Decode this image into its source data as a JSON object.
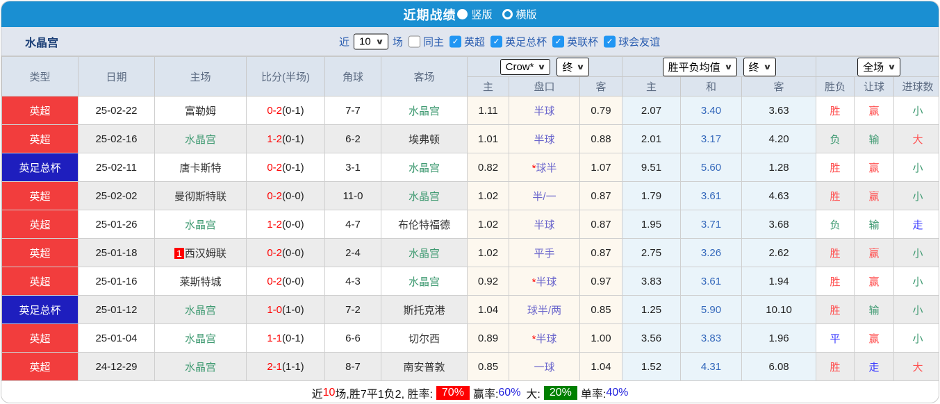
{
  "icons": {
    "chevron_down": "∨",
    "check": "✓"
  },
  "colors": {
    "titlebar_blue": "#1a8fd2",
    "filterbar_gray": "#e1e6ef",
    "header_gray": "#dce4ee",
    "type_red": "#f23d3d",
    "type_blue": "#1e1ebe",
    "team_green": "#3d9970",
    "score_red": "#fe0000",
    "handicap_purple": "#6b66cc",
    "draw_blue": "#3468bb",
    "result_red": "#ff5252",
    "result_green": "#3d9970",
    "result_blue": "#3b3bff",
    "asia_bg": "#fdf8ef",
    "euro_bg": "#eaf4fa",
    "checkbox_blue": "#2196f3",
    "badge_red": "#fe0000",
    "badge_green": "#008000"
  },
  "title_bar": {
    "title": "近期战绩",
    "vertical_label": "竖版",
    "horizontal_label": "横版"
  },
  "filter_bar": {
    "team": "水晶宫",
    "near_label": "近",
    "count_value": "10",
    "unit_label": "场",
    "same_home": {
      "label": "同主",
      "state": "unchecked"
    },
    "leagues": [
      {
        "label": "英超",
        "state": "checked"
      },
      {
        "label": "英足总杯",
        "state": "checked"
      },
      {
        "label": "英联杯",
        "state": "checked"
      },
      {
        "label": "球会友谊",
        "state": "checked"
      }
    ]
  },
  "table": {
    "selects": {
      "bookmaker": "Crow*",
      "asia_stage": "终",
      "euro_name": "胜平负均值",
      "euro_stage": "终",
      "scope": "全场"
    },
    "headers": {
      "type": "类型",
      "date": "日期",
      "home": "主场",
      "score": "比分(半场)",
      "corner": "角球",
      "away": "客场",
      "asia_home": "主",
      "handicap": "盘口",
      "asia_away": "客",
      "euro_home": "主",
      "euro_draw": "和",
      "euro_away": "客",
      "result": "胜负",
      "let_result": "让球",
      "goals": "进球数"
    },
    "rows": [
      {
        "type": "英超",
        "type_color": "red",
        "date": "25-02-22",
        "rank": "",
        "home": "富勒姆",
        "home_color": "dark",
        "score": "0-2",
        "half": "(0-1)",
        "corner": "7-7",
        "away": "水晶宫",
        "away_color": "green",
        "asia_home": "1.11",
        "star": "",
        "handicap": "半球",
        "asia_away": "0.79",
        "euro_home": "2.07",
        "euro_draw": "3.40",
        "euro_away": "3.63",
        "result": "胜",
        "result_color": "red",
        "let_result": "赢",
        "let_color": "red",
        "goal": "小",
        "goal_color": "green"
      },
      {
        "type": "英超",
        "type_color": "red",
        "date": "25-02-16",
        "rank": "",
        "home": "水晶宫",
        "home_color": "green",
        "score": "1-2",
        "half": "(0-1)",
        "corner": "6-2",
        "away": "埃弗顿",
        "away_color": "dark",
        "asia_home": "1.01",
        "star": "",
        "handicap": "半球",
        "asia_away": "0.88",
        "euro_home": "2.01",
        "euro_draw": "3.17",
        "euro_away": "4.20",
        "result": "负",
        "result_color": "green",
        "let_result": "输",
        "let_color": "green",
        "goal": "大",
        "goal_color": "red"
      },
      {
        "type": "英足总杯",
        "type_color": "blue",
        "date": "25-02-11",
        "rank": "",
        "home": "唐卡斯特",
        "home_color": "dark",
        "score": "0-2",
        "half": "(0-1)",
        "corner": "3-1",
        "away": "水晶宫",
        "away_color": "green",
        "asia_home": "0.82",
        "star": "*",
        "handicap": "球半",
        "asia_away": "1.07",
        "euro_home": "9.51",
        "euro_draw": "5.60",
        "euro_away": "1.28",
        "result": "胜",
        "result_color": "red",
        "let_result": "赢",
        "let_color": "red",
        "goal": "小",
        "goal_color": "green"
      },
      {
        "type": "英超",
        "type_color": "red",
        "date": "25-02-02",
        "rank": "",
        "home": "曼彻斯特联",
        "home_color": "dark",
        "score": "0-2",
        "half": "(0-0)",
        "corner": "11-0",
        "away": "水晶宫",
        "away_color": "green",
        "asia_home": "1.02",
        "star": "",
        "handicap": "半/一",
        "asia_away": "0.87",
        "euro_home": "1.79",
        "euro_draw": "3.61",
        "euro_away": "4.63",
        "result": "胜",
        "result_color": "red",
        "let_result": "赢",
        "let_color": "red",
        "goal": "小",
        "goal_color": "green"
      },
      {
        "type": "英超",
        "type_color": "red",
        "date": "25-01-26",
        "rank": "",
        "home": "水晶宫",
        "home_color": "green",
        "score": "1-2",
        "half": "(0-0)",
        "corner": "4-7",
        "away": "布伦特福德",
        "away_color": "dark",
        "asia_home": "1.02",
        "star": "",
        "handicap": "半球",
        "asia_away": "0.87",
        "euro_home": "1.95",
        "euro_draw": "3.71",
        "euro_away": "3.68",
        "result": "负",
        "result_color": "green",
        "let_result": "输",
        "let_color": "green",
        "goal": "走",
        "goal_color": "blue"
      },
      {
        "type": "英超",
        "type_color": "red",
        "date": "25-01-18",
        "rank": "1",
        "home": "西汉姆联",
        "home_color": "dark",
        "score": "0-2",
        "half": "(0-0)",
        "corner": "2-4",
        "away": "水晶宫",
        "away_color": "green",
        "asia_home": "1.02",
        "star": "",
        "handicap": "平手",
        "asia_away": "0.87",
        "euro_home": "2.75",
        "euro_draw": "3.26",
        "euro_away": "2.62",
        "result": "胜",
        "result_color": "red",
        "let_result": "赢",
        "let_color": "red",
        "goal": "小",
        "goal_color": "green"
      },
      {
        "type": "英超",
        "type_color": "red",
        "date": "25-01-16",
        "rank": "",
        "home": "莱斯特城",
        "home_color": "dark",
        "score": "0-2",
        "half": "(0-0)",
        "corner": "4-3",
        "away": "水晶宫",
        "away_color": "green",
        "asia_home": "0.92",
        "star": "*",
        "handicap": "半球",
        "asia_away": "0.97",
        "euro_home": "3.83",
        "euro_draw": "3.61",
        "euro_away": "1.94",
        "result": "胜",
        "result_color": "red",
        "let_result": "赢",
        "let_color": "red",
        "goal": "小",
        "goal_color": "green"
      },
      {
        "type": "英足总杯",
        "type_color": "blue",
        "date": "25-01-12",
        "rank": "",
        "home": "水晶宫",
        "home_color": "green",
        "score": "1-0",
        "half": "(1-0)",
        "corner": "7-2",
        "away": "斯托克港",
        "away_color": "dark",
        "asia_home": "1.04",
        "star": "",
        "handicap": "球半/两",
        "asia_away": "0.85",
        "euro_home": "1.25",
        "euro_draw": "5.90",
        "euro_away": "10.10",
        "result": "胜",
        "result_color": "red",
        "let_result": "输",
        "let_color": "green",
        "goal": "小",
        "goal_color": "green"
      },
      {
        "type": "英超",
        "type_color": "red",
        "date": "25-01-04",
        "rank": "",
        "home": "水晶宫",
        "home_color": "green",
        "score": "1-1",
        "half": "(0-1)",
        "corner": "6-6",
        "away": "切尔西",
        "away_color": "dark",
        "asia_home": "0.89",
        "star": "*",
        "handicap": "半球",
        "asia_away": "1.00",
        "euro_home": "3.56",
        "euro_draw": "3.83",
        "euro_away": "1.96",
        "result": "平",
        "result_color": "blue",
        "let_result": "赢",
        "let_color": "red",
        "goal": "小",
        "goal_color": "green"
      },
      {
        "type": "英超",
        "type_color": "red",
        "date": "24-12-29",
        "rank": "",
        "home": "水晶宫",
        "home_color": "green",
        "score": "2-1",
        "half": "(1-1)",
        "corner": "8-7",
        "away": "南安普敦",
        "away_color": "dark",
        "asia_home": "0.85",
        "star": "",
        "handicap": "一球",
        "asia_away": "1.04",
        "euro_home": "1.52",
        "euro_draw": "4.31",
        "euro_away": "6.08",
        "result": "胜",
        "result_color": "red",
        "let_result": "走",
        "let_color": "blue",
        "goal": "大",
        "goal_color": "red"
      }
    ]
  },
  "footer": {
    "near_label": "近",
    "count": "10",
    "summary": "场,胜7平1负2, 胜率:",
    "win_rate": "70%",
    "let_label": "赢率:",
    "let_rate": "60%",
    "big_label": "大:",
    "big_rate": "20%",
    "single_label": "单率:",
    "single_rate": "40%"
  }
}
